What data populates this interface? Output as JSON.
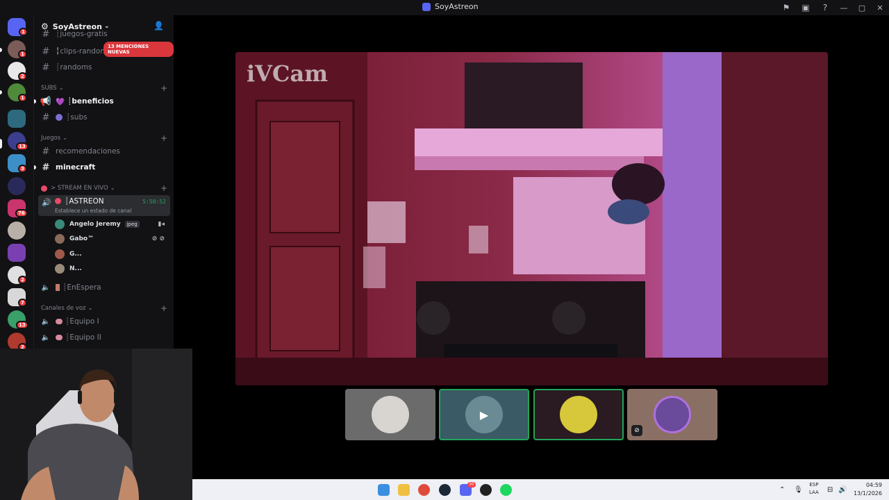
{
  "window": {
    "title": "SoyAstreon"
  },
  "server": {
    "name": "SoyAstreon"
  },
  "sidebar": {
    "mentions_pill": "13 MENCIONES NUEVAS",
    "top_channels": [
      {
        "label": "┊juegos-gratis"
      },
      {
        "label": "╏clips-random"
      },
      {
        "label": "┊randoms"
      }
    ],
    "categories": {
      "subs": "SUBS",
      "juegos": "Juegos",
      "stream": "> STREAM EN VIVO",
      "voz": "Canales de voz"
    },
    "subs_channels": [
      {
        "label": "┊beneficios",
        "emoji": "💜"
      },
      {
        "label": "┊subs"
      }
    ],
    "juegos_channels": [
      {
        "label": "recomendaciones"
      },
      {
        "label": "minecraft"
      }
    ],
    "active_voice": {
      "name": "┊ASTREON",
      "timer": "5:50:52",
      "status": "Establece un estado de canal"
    },
    "voice_users": [
      {
        "name": "Angelo Jeremy",
        "tag": "jpeg"
      },
      {
        "name": "Gabo™"
      },
      {
        "name": "G..."
      },
      {
        "name": "N..."
      }
    ],
    "other_voice": [
      {
        "label": "┊EnEspera"
      },
      {
        "label": "┊Equipo I"
      },
      {
        "label": "┊Equipo II"
      }
    ]
  },
  "rail": {
    "badges": [
      "1",
      "1",
      "2",
      "1",
      "13",
      "3",
      "76",
      "2",
      "7",
      "13",
      "2"
    ]
  },
  "stage": {
    "watermark": "iVCam"
  },
  "taskbar": {
    "lang_line1": "ESP",
    "lang_line2": "LAA",
    "time": "04:59",
    "date": "13/1/2026",
    "discord_badge": "30"
  },
  "colors": {
    "accent": "#5865f2",
    "voice_green": "#23a55a",
    "mention_red": "#da373c"
  }
}
